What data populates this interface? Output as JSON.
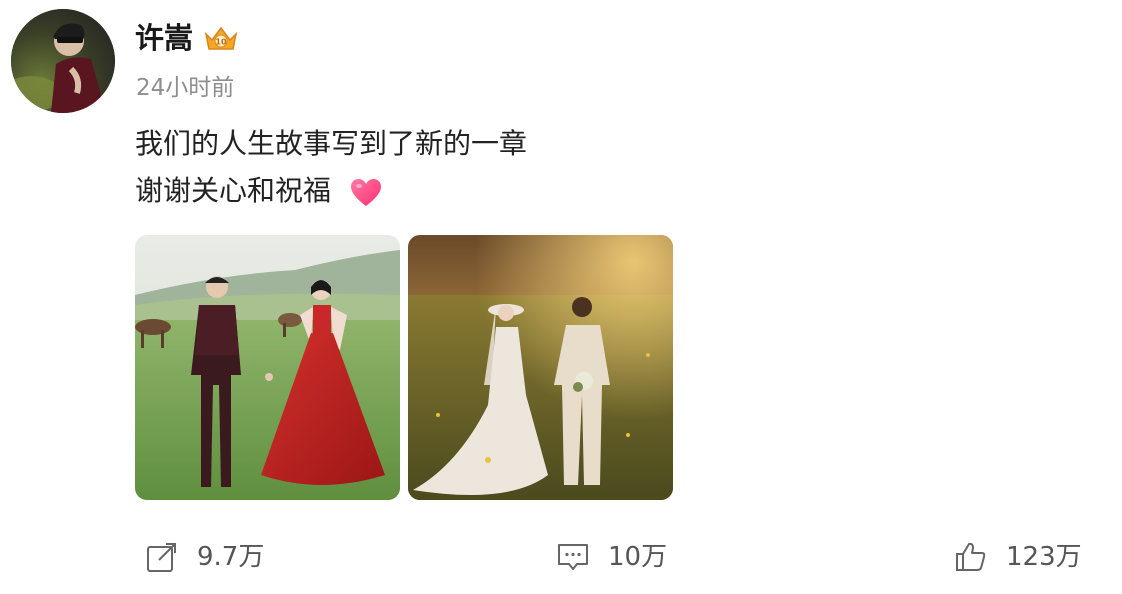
{
  "post": {
    "author": {
      "name": "许嵩",
      "badge_icon": "vip-crown-badge-icon"
    },
    "timestamp": "24小时前",
    "text_lines": [
      "我们的人生故事写到了新的一章",
      "谢谢关心和祝福"
    ],
    "emoji": "pink-heart-icon",
    "images": [
      {
        "description_icon": "wedding-photo-grassland-red-dress"
      },
      {
        "description_icon": "wedding-photo-sunset-white-dress"
      }
    ]
  },
  "actions": {
    "repost": {
      "icon": "repost-icon",
      "count": "9.7万"
    },
    "comment": {
      "icon": "comment-icon",
      "count": "10万"
    },
    "like": {
      "icon": "thumbs-up-icon",
      "count": "123万"
    }
  },
  "colors": {
    "text_primary": "#222222",
    "text_secondary": "#8e8e8e",
    "heart": "#ff3d7f",
    "badge": "#f5a623"
  }
}
